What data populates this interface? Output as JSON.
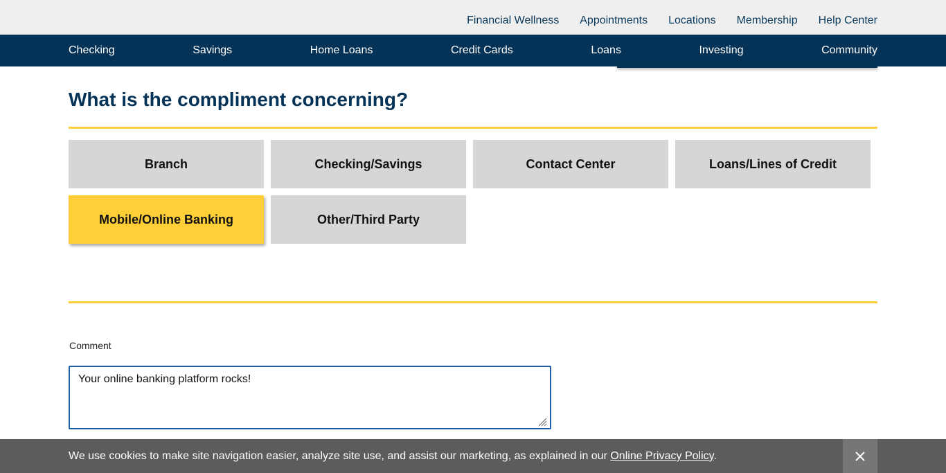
{
  "utility_nav": [
    "Financial Wellness",
    "Appointments",
    "Locations",
    "Membership",
    "Help Center"
  ],
  "main_nav": [
    "Checking",
    "Savings",
    "Home Loans",
    "Credit Cards",
    "Loans",
    "Investing",
    "Community"
  ],
  "question": "What is the compliment concerning?",
  "options": [
    {
      "label": "Branch",
      "selected": false
    },
    {
      "label": "Checking/Savings",
      "selected": false
    },
    {
      "label": "Contact Center",
      "selected": false
    },
    {
      "label": "Loans/Lines of Credit",
      "selected": false
    },
    {
      "label": "Mobile/Online Banking",
      "selected": true
    },
    {
      "label": "Other/Third Party",
      "selected": false
    }
  ],
  "comment": {
    "label": "Comment",
    "value": "Your online banking platform rocks!"
  },
  "cookie": {
    "text": "We use cookies to make site navigation easier, analyze site use, and assist our marketing, as explained in our ",
    "link": "Online Privacy Policy",
    "suffix": "."
  },
  "colors": {
    "navy": "#053357",
    "accent_yellow": "#fecf37",
    "option_grey": "#d6d6d6"
  }
}
